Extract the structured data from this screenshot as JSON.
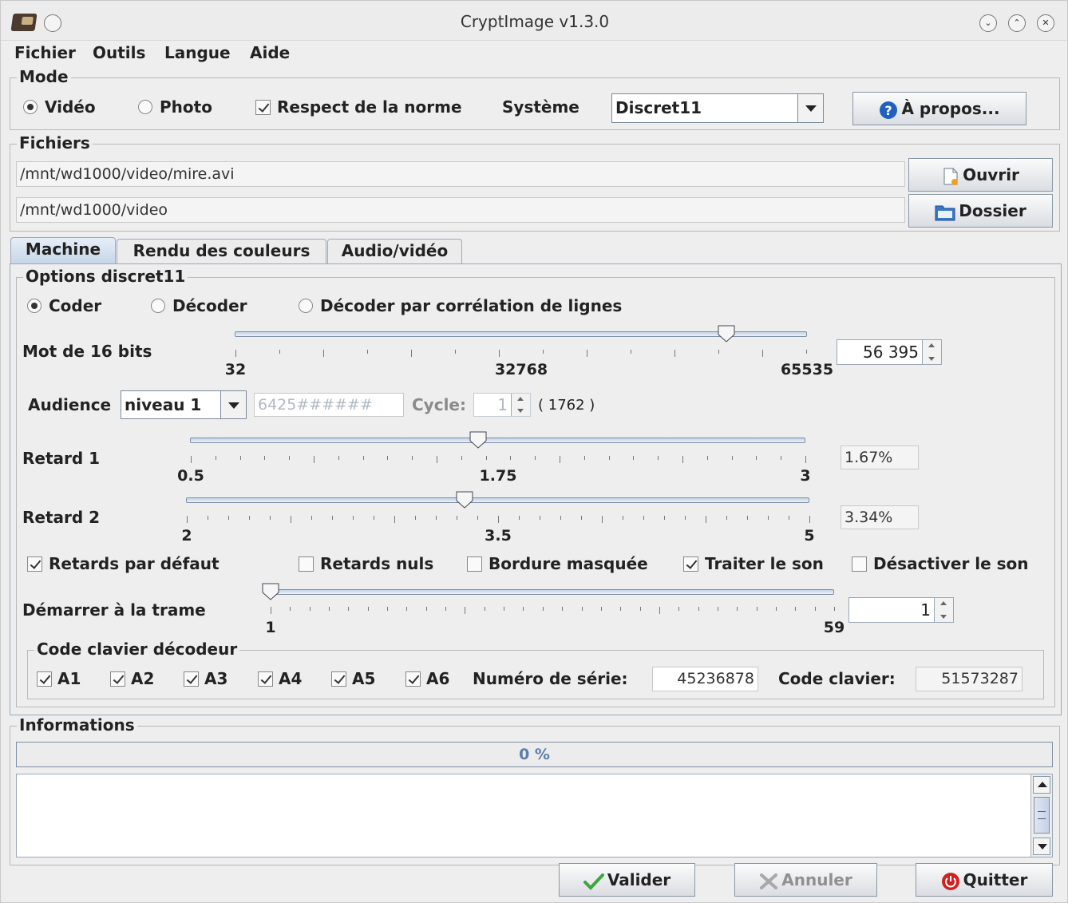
{
  "window": {
    "title": "CryptImage v1.3.0"
  },
  "menu": [
    "Fichier",
    "Outils",
    "Langue",
    "Aide"
  ],
  "mode": {
    "legend": "Mode",
    "video": "Vidéo",
    "photo": "Photo",
    "respect": "Respect de la norme",
    "systeme_label": "Système",
    "systeme_value": "Discret11",
    "apropos": "À propos..."
  },
  "fichiers": {
    "legend": "Fichiers",
    "input_path": "/mnt/wd1000/video/mire.avi",
    "output_path": "/mnt/wd1000/video",
    "ouvrir": "Ouvrir",
    "dossier": "Dossier"
  },
  "tabs": [
    "Machine",
    "Rendu des couleurs",
    "Audio/vidéo"
  ],
  "options": {
    "legend": "Options discret11",
    "coder": "Coder",
    "decoder": "Décoder",
    "decoder_corr": "Décoder par corrélation de lignes",
    "mot_label": "Mot de 16 bits",
    "mot_min": "32",
    "mot_mid": "32768",
    "mot_max": "65535",
    "mot_value": "56 395",
    "mot_slider": 56395,
    "audience_label": "Audience",
    "audience_value": "niveau 1",
    "audience_code": "6425######",
    "cycle_label": "Cycle:",
    "cycle_value": "1",
    "cycle_count": "( 1762 )",
    "retard1_label": "Retard 1",
    "retard1_min": "0.5",
    "retard1_mid": "1.75",
    "retard1_max": "3",
    "retard1_value": "1.67%",
    "retard1_slider": 1.67,
    "retard2_label": "Retard 2",
    "retard2_min": "2",
    "retard2_mid": "3.5",
    "retard2_max": "5",
    "retard2_value": "3.34%",
    "retard2_slider": 3.34,
    "cb_defaut": "Retards par défaut",
    "cb_nuls": "Retards nuls",
    "cb_bordure": "Bordure masquée",
    "cb_son": "Traiter le son",
    "cb_desactiver": "Désactiver le son",
    "trame_label": "Démarrer à la trame",
    "trame_min": "1",
    "trame_max": "59",
    "trame_value": "1",
    "trame_slider": 1
  },
  "clavier": {
    "legend": "Code clavier décodeur",
    "a1": "A1",
    "a2": "A2",
    "a3": "A3",
    "a4": "A4",
    "a5": "A5",
    "a6": "A6",
    "serie_label": "Numéro de série:",
    "serie_value": "45236878",
    "code_label": "Code clavier:",
    "code_value": "51573287"
  },
  "informations": {
    "legend": "Informations",
    "progress": "0 %",
    "progress_fraction": 0
  },
  "buttons": {
    "valider": "Valider",
    "annuler": "Annuler",
    "quitter": "Quitter"
  },
  "colors": {
    "accent": "#c4d2e6",
    "progress_text": "#5b7db0",
    "ok_green": "#3aa83a",
    "quit_red": "#d22020",
    "help_blue": "#2060c0"
  }
}
